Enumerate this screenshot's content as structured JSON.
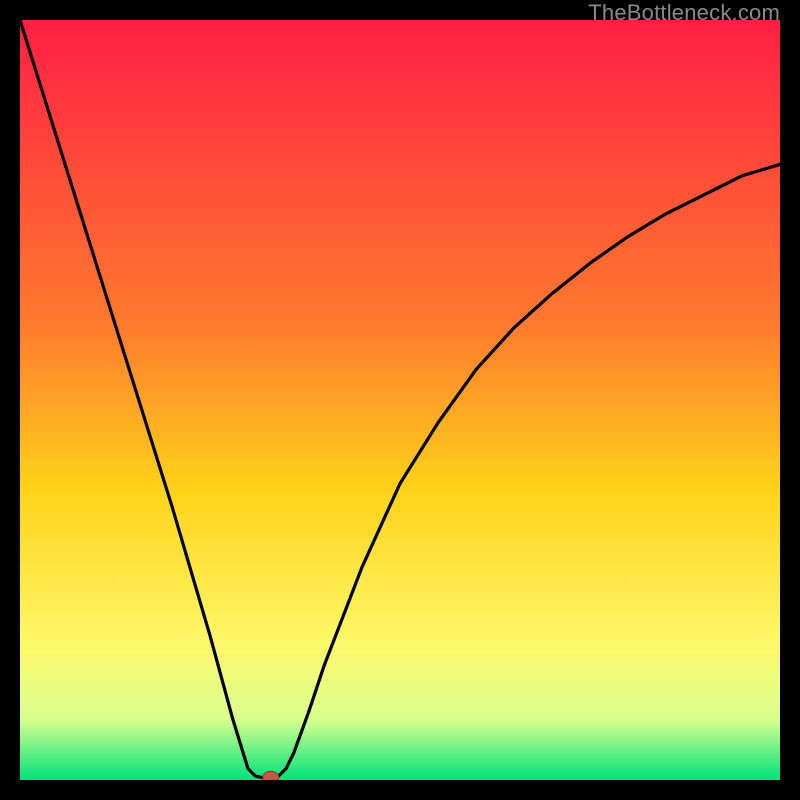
{
  "watermark": "TheBottleneck.com",
  "colors": {
    "top": "#ff1f44",
    "mid1": "#ff7a2e",
    "mid2": "#ffd31a",
    "mid3": "#fff86a",
    "mid4": "#d9ff90",
    "bottom": "#00e37a",
    "curve": "#000000",
    "dot_fill": "#c05a4a",
    "dot_stroke": "#8b3d30",
    "frame": "#000000"
  },
  "chart_data": {
    "type": "line",
    "title": "",
    "xlabel": "",
    "ylabel": "",
    "xlim": [
      0,
      100
    ],
    "ylim": [
      0,
      100
    ],
    "series": [
      {
        "name": "bottleneck-curve",
        "x": [
          0,
          5,
          10,
          15,
          20,
          25,
          28,
          30,
          31,
          32,
          33,
          34,
          35,
          36,
          38,
          40,
          45,
          50,
          55,
          60,
          65,
          70,
          75,
          80,
          85,
          90,
          95,
          100
        ],
        "values": [
          100,
          84,
          68,
          52,
          36,
          19,
          8,
          1.5,
          0.5,
          0.3,
          0.3,
          0.5,
          1.5,
          3.5,
          9,
          15,
          28,
          39,
          47,
          54,
          59.5,
          64,
          68,
          71.5,
          74.5,
          77,
          79.5,
          81
        ]
      }
    ],
    "marker": {
      "x": 33,
      "y": 0.3,
      "label": "optimum-point"
    },
    "grid": false,
    "legend": false
  }
}
